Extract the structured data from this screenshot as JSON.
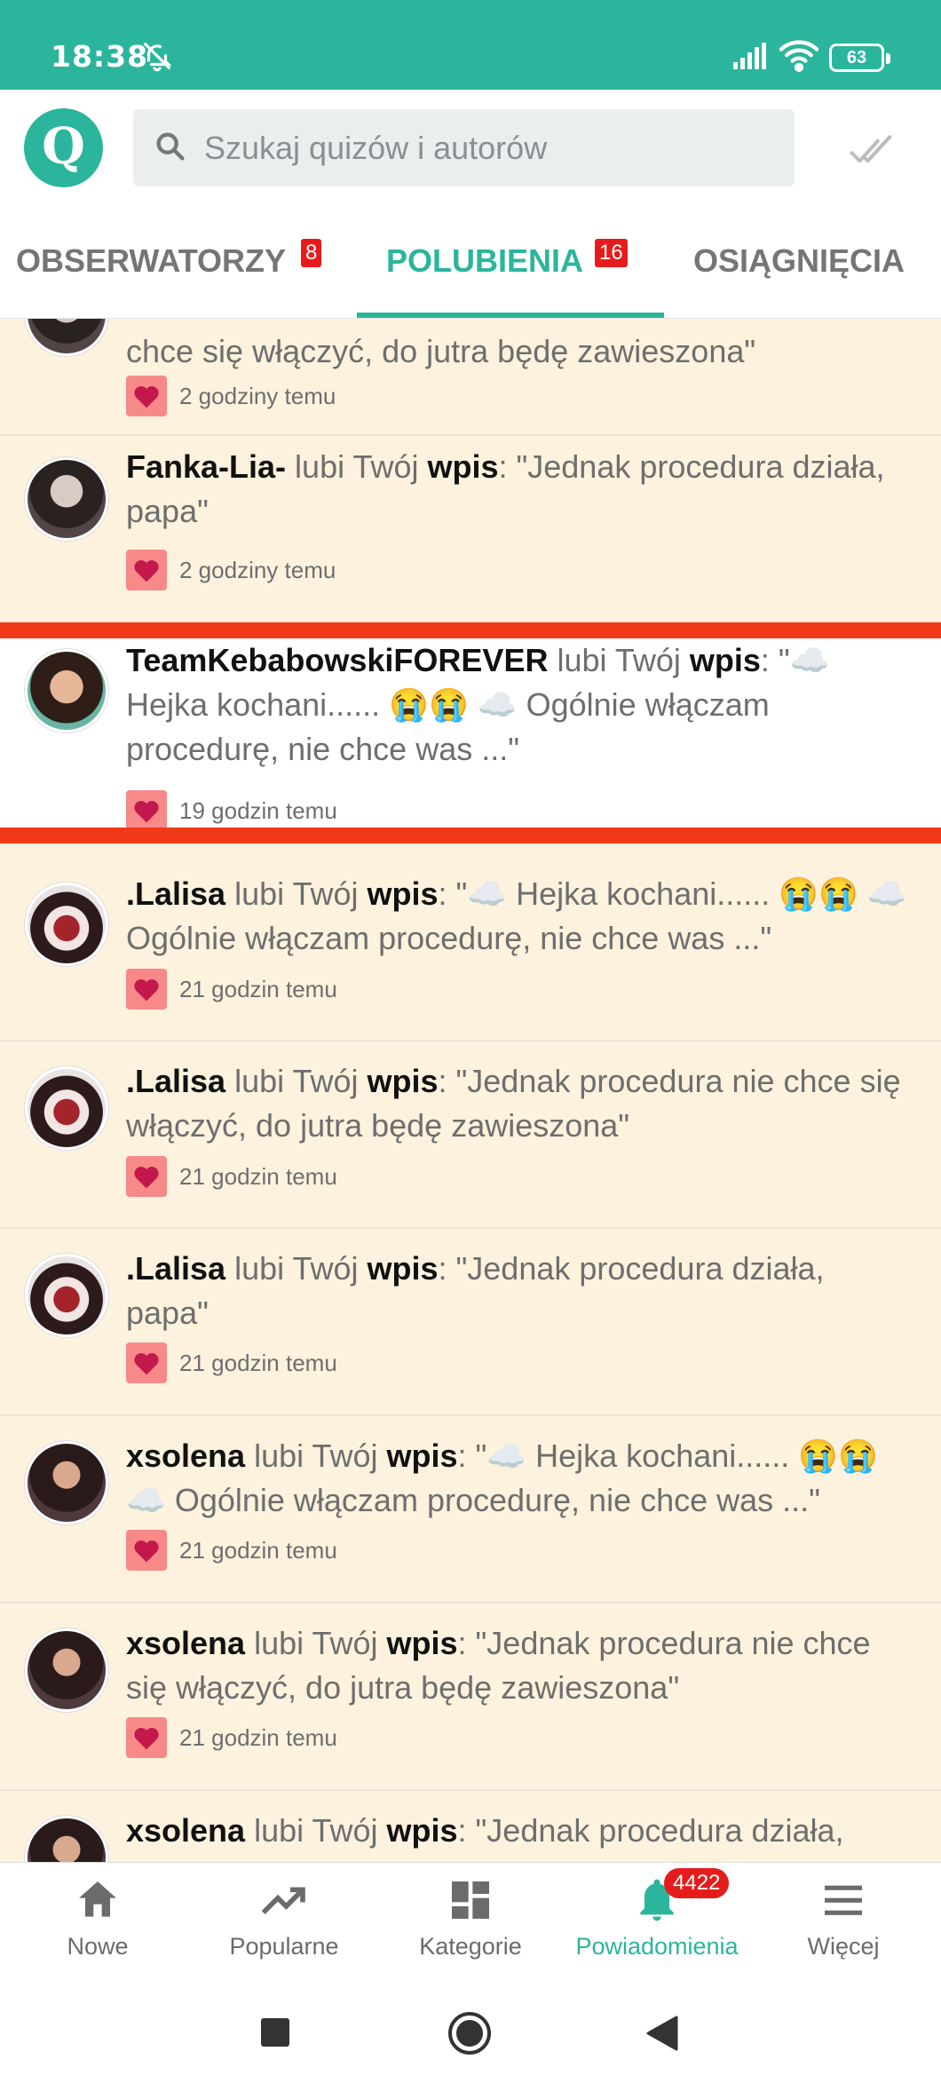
{
  "status_bar": {
    "time": "18:38",
    "battery": "63"
  },
  "header": {
    "logo_letter": "Q",
    "search_placeholder": "Szukaj quizów i autorów"
  },
  "tabs": [
    {
      "label": "OBSERWATORZY",
      "badge": "8",
      "active": false
    },
    {
      "label": "POLUBIENIA",
      "badge": "16",
      "active": true
    },
    {
      "label": "OSIĄGNIĘCIA",
      "badge": "",
      "active": false
    }
  ],
  "notifications": [
    {
      "user": "",
      "action": "",
      "type": "",
      "text": "chce się włączyć, do jutra będę zawieszona\"",
      "time": "2 godziny temu",
      "avatar": "dark",
      "read": false
    },
    {
      "user": "Fanka-Lia-",
      "action": " lubi Twój ",
      "type": "wpis",
      "text": ": \"Jednak procedura działa, papa\"",
      "time": "2 godziny temu",
      "avatar": "dark",
      "read": false
    },
    {
      "user": "TeamKebabowskiFOREVER",
      "action": " lubi Twój ",
      "type": "wpis",
      "text": ": \"☁️ Hejka kochani...... 😭😭 ☁️ Ogólnie włączam procedurę, nie chce was ...\"",
      "time": "19 godzin temu",
      "avatar": "girl",
      "read": true
    },
    {
      "user": ".Lalisa",
      "action": " lubi Twój ",
      "type": "wpis",
      "text": ": \"☁️ Hejka kochani...... 😭😭 ☁️ Ogólnie włączam procedurę, nie chce was ...\"",
      "time": "21 godzin temu",
      "avatar": "red",
      "read": false
    },
    {
      "user": ".Lalisa",
      "action": " lubi Twój ",
      "type": "wpis",
      "text": ": \"Jednak procedura nie chce się włączyć, do jutra będę zawieszona\"",
      "time": "21 godzin temu",
      "avatar": "red",
      "read": false
    },
    {
      "user": ".Lalisa",
      "action": " lubi Twój ",
      "type": "wpis",
      "text": ": \"Jednak procedura działa, papa\"",
      "time": "21 godzin temu",
      "avatar": "red",
      "read": false
    },
    {
      "user": "xsolena",
      "action": " lubi Twój ",
      "type": "wpis",
      "text": ": \"☁️ Hejka kochani...... 😭😭 ☁️ Ogólnie włączam procedurę, nie chce was ...\"",
      "time": "21 godzin temu",
      "avatar": "solena",
      "read": false
    },
    {
      "user": "xsolena",
      "action": " lubi Twój ",
      "type": "wpis",
      "text": ": \"Jednak procedura nie chce się włączyć, do jutra będę zawieszona\"",
      "time": "21 godzin temu",
      "avatar": "solena",
      "read": false
    },
    {
      "user": "xsolena",
      "action": " lubi Twój ",
      "type": "wpis",
      "text": ": \"Jednak procedura działa,",
      "time": "",
      "avatar": "solena",
      "read": false
    }
  ],
  "bottom_nav": [
    {
      "label": "Nowe",
      "icon": "home-icon",
      "active": false,
      "badge": ""
    },
    {
      "label": "Popularne",
      "icon": "trending-icon",
      "active": false,
      "badge": ""
    },
    {
      "label": "Kategorie",
      "icon": "dashboard-icon",
      "active": false,
      "badge": ""
    },
    {
      "label": "Powiadomienia",
      "icon": "bell-icon",
      "active": true,
      "badge": "4422"
    },
    {
      "label": "Więcej",
      "icon": "menu-icon",
      "active": false,
      "badge": ""
    }
  ],
  "colors": {
    "brand": "#2bb59c",
    "highlight": "#f03a17",
    "unread_bg": "#fdf2dd",
    "badge": "#e61c1c"
  }
}
